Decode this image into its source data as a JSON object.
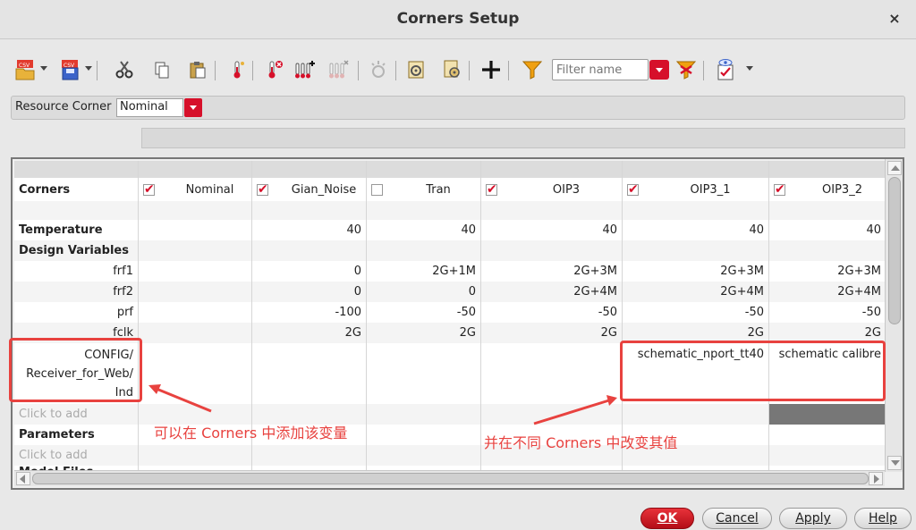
{
  "window": {
    "title": "Corners Setup",
    "close_glyph": "×"
  },
  "toolbar": {
    "filter_placeholder": "Filter name",
    "icons": [
      "open-csv-icon",
      "save-csv-icon",
      "cut-icon",
      "copy-icon",
      "paste-icon",
      "add-temperature-icon",
      "delete-temperature-icon",
      "add-variable-icon",
      "remove-variable-icon",
      "clear-icon",
      "load-corner-icon",
      "import-corner-icon",
      "add-corner-icon",
      "filter-icon",
      "clear-filter-icon",
      "view-options-icon"
    ]
  },
  "resource": {
    "label": "Resource Corner",
    "value": "Nominal"
  },
  "grid": {
    "row_header": "Corners",
    "corners": [
      {
        "name": "Nominal",
        "checked": true
      },
      {
        "name": "Gian_Noise",
        "checked": true
      },
      {
        "name": "Tran",
        "checked": false
      },
      {
        "name": "OIP3",
        "checked": true
      },
      {
        "name": "OIP3_1",
        "checked": true
      },
      {
        "name": "OIP3_2",
        "checked": true
      }
    ],
    "temperature": {
      "label": "Temperature",
      "values": [
        "",
        "40",
        "40",
        "40",
        "40",
        "40"
      ]
    },
    "design_variables_label": "Design Variables",
    "variables": [
      {
        "name": "frf1",
        "values": [
          "",
          "0",
          "2G+1M",
          "2G+3M",
          "2G+3M",
          "2G+3M"
        ]
      },
      {
        "name": "frf2",
        "values": [
          "",
          "0",
          "0",
          "2G+4M",
          "2G+4M",
          "2G+4M"
        ]
      },
      {
        "name": "prf",
        "values": [
          "",
          "-100",
          "-50",
          "-50",
          "-50",
          "-50"
        ]
      },
      {
        "name": "fclk",
        "values": [
          "",
          "2G",
          "2G",
          "2G",
          "2G",
          "2G"
        ]
      }
    ],
    "config_var": {
      "lines": [
        "CONFIG/",
        "Receiver_for_Web/",
        "Ind"
      ],
      "values": [
        "",
        "",
        "",
        "",
        "schematic_nport_tt40",
        "schematic calibre"
      ]
    },
    "click_to_add": "Click to add",
    "parameters_label": "Parameters",
    "model_files_label": "Model Files"
  },
  "annotations": {
    "left_note": "可以在 Corners 中添加该变量",
    "right_note": "并在不同 Corners 中改变其值",
    "color": "#e8423f"
  },
  "buttons": {
    "ok": "OK",
    "cancel": "Cancel",
    "apply": "Apply",
    "help": "Help"
  }
}
